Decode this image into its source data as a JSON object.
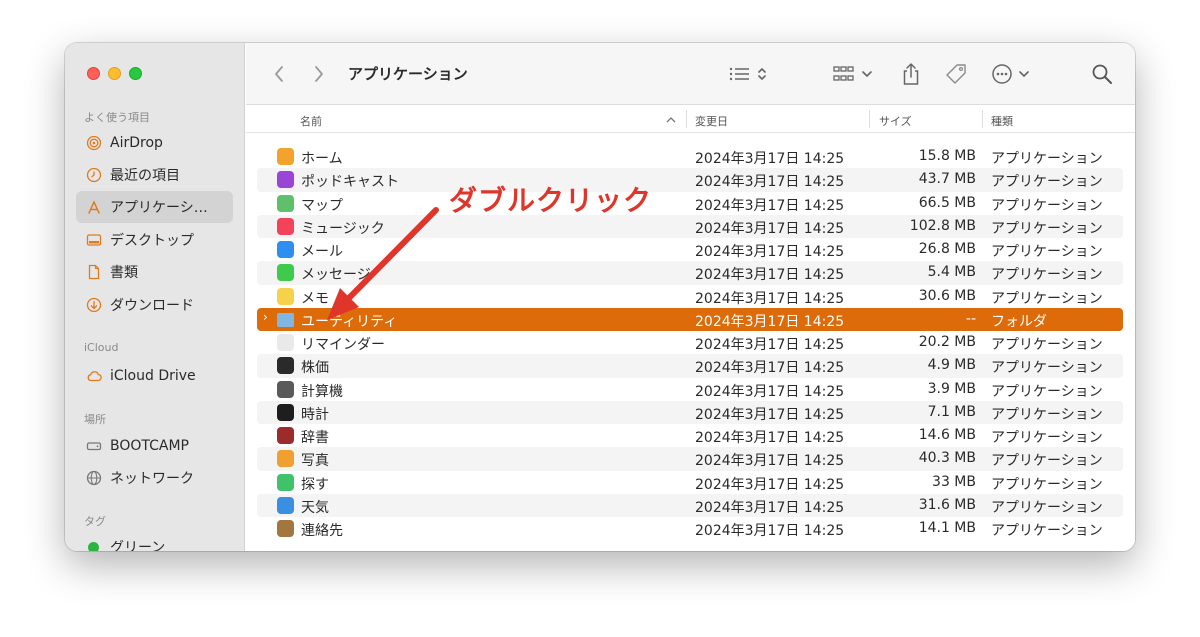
{
  "sidebar": {
    "sections": {
      "favorites": "よく使う項目",
      "icloud": "iCloud",
      "locations": "場所",
      "tags": "タグ"
    },
    "favorites": [
      {
        "label": "AirDrop",
        "icon": "airdrop-icon"
      },
      {
        "label": "最近の項目",
        "icon": "clock-icon"
      },
      {
        "label": "アプリケーシ…",
        "icon": "applications-icon",
        "active": true
      },
      {
        "label": "デスクトップ",
        "icon": "desktop-icon"
      },
      {
        "label": "書類",
        "icon": "document-icon"
      },
      {
        "label": "ダウンロード",
        "icon": "download-icon"
      }
    ],
    "icloud": [
      {
        "label": "iCloud Drive",
        "icon": "cloud-icon"
      }
    ],
    "locations": [
      {
        "label": "BOOTCAMP",
        "icon": "drive-icon"
      },
      {
        "label": "ネットワーク",
        "icon": "globe-icon"
      }
    ],
    "tags": [
      {
        "label": "グリーン",
        "color": "#29b53e"
      }
    ]
  },
  "toolbar": {
    "title": "アプリケーション",
    "back_icon": "chevron-left-icon",
    "forward_icon": "chevron-right-icon",
    "view_icon": "list-view-icon",
    "group_icon": "grid-group-icon",
    "share_icon": "share-icon",
    "tag_icon": "tag-icon",
    "more_icon": "ellipsis-circle-icon",
    "search_icon": "search-icon"
  },
  "columns": {
    "name": "名前",
    "date": "変更日",
    "size": "サイズ",
    "kind": "種類"
  },
  "rows": [
    {
      "name": "ホーム",
      "date": "2024年3月17日 14:25",
      "size": "15.8 MB",
      "kind": "アプリケーション",
      "icon_color": "#f3a22c"
    },
    {
      "name": "ポッドキャスト",
      "date": "2024年3月17日 14:25",
      "size": "43.7 MB",
      "kind": "アプリケーション",
      "icon_color": "#9a45d6"
    },
    {
      "name": "マップ",
      "date": "2024年3月17日 14:25",
      "size": "66.5 MB",
      "kind": "アプリケーション",
      "icon_color": "#5fbf6b"
    },
    {
      "name": "ミュージック",
      "date": "2024年3月17日 14:25",
      "size": "102.8 MB",
      "kind": "アプリケーション",
      "icon_color": "#f2435a"
    },
    {
      "name": "メール",
      "date": "2024年3月17日 14:25",
      "size": "26.8 MB",
      "kind": "アプリケーション",
      "icon_color": "#2e8ff0"
    },
    {
      "name": "メッセージ",
      "date": "2024年3月17日 14:25",
      "size": "5.4 MB",
      "kind": "アプリケーション",
      "icon_color": "#3ecb4c"
    },
    {
      "name": "メモ",
      "date": "2024年3月17日 14:25",
      "size": "30.6 MB",
      "kind": "アプリケーション",
      "icon_color": "#f6d24a"
    },
    {
      "name": "ユーティリティ",
      "date": "2024年3月17日 14:25",
      "size": "--",
      "kind": "フォルダ",
      "icon_color": "#7fb6e3",
      "selected": true,
      "folder": true
    },
    {
      "name": "リマインダー",
      "date": "2024年3月17日 14:25",
      "size": "20.2 MB",
      "kind": "アプリケーション",
      "icon_color": "#e9e9e9"
    },
    {
      "name": "株価",
      "date": "2024年3月17日 14:25",
      "size": "4.9 MB",
      "kind": "アプリケーション",
      "icon_color": "#2a2a2a"
    },
    {
      "name": "計算機",
      "date": "2024年3月17日 14:25",
      "size": "3.9 MB",
      "kind": "アプリケーション",
      "icon_color": "#5a5a5a"
    },
    {
      "name": "時計",
      "date": "2024年3月17日 14:25",
      "size": "7.1 MB",
      "kind": "アプリケーション",
      "icon_color": "#1e1e1e"
    },
    {
      "name": "辞書",
      "date": "2024年3月17日 14:25",
      "size": "14.6 MB",
      "kind": "アプリケーション",
      "icon_color": "#9c2b2b"
    },
    {
      "name": "写真",
      "date": "2024年3月17日 14:25",
      "size": "40.3 MB",
      "kind": "アプリケーション",
      "icon_color": "#f0a030"
    },
    {
      "name": "探す",
      "date": "2024年3月17日 14:25",
      "size": "33 MB",
      "kind": "アプリケーション",
      "icon_color": "#3fc26a"
    },
    {
      "name": "天気",
      "date": "2024年3月17日 14:25",
      "size": "31.6 MB",
      "kind": "アプリケーション",
      "icon_color": "#3a8fe0"
    },
    {
      "name": "連絡先",
      "date": "2024年3月17日 14:25",
      "size": "14.1 MB",
      "kind": "アプリケーション",
      "icon_color": "#a2763f"
    }
  ],
  "annotation": {
    "label": "ダブルクリック",
    "color": "#e0352b"
  },
  "colors": {
    "selection": "#dd6b0a",
    "accent": "#e0352b"
  }
}
